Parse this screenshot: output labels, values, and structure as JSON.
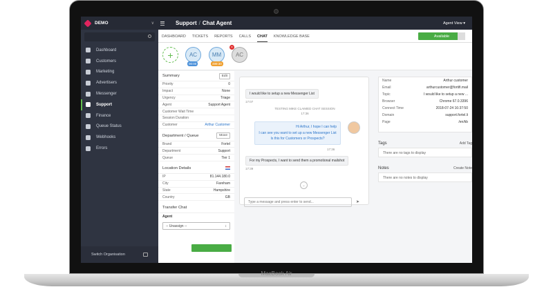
{
  "device": {
    "label": "MacBook Air"
  },
  "sidebar": {
    "brand": "DEMO",
    "items": [
      {
        "label": "Dashboard",
        "icon": "dashboard-icon"
      },
      {
        "label": "Customers",
        "icon": "customers-icon"
      },
      {
        "label": "Marketing",
        "icon": "marketing-icon"
      },
      {
        "label": "Advertisers",
        "icon": "advertisers-icon"
      },
      {
        "label": "Messenger",
        "icon": "messenger-icon"
      },
      {
        "label": "Support",
        "icon": "support-icon",
        "active": true
      },
      {
        "label": "Finance",
        "icon": "finance-icon"
      },
      {
        "label": "Queue Status",
        "icon": "queue-icon"
      },
      {
        "label": "Webhooks",
        "icon": "webhooks-icon"
      },
      {
        "label": "Errors",
        "icon": "errors-icon"
      }
    ],
    "switch_org": "Switch Organisation"
  },
  "topbar": {
    "crumb1": "Support",
    "sep": "/",
    "crumb2": "Chat Agent",
    "agent_view": "Agent View ▾"
  },
  "tabs": [
    "DASHBOARD",
    "TICKETS",
    "REPORTS",
    "CALLS",
    "CHAT",
    "KNOWLEDGE BASE"
  ],
  "active_tab": "CHAT",
  "status": {
    "label": "Available",
    "color": "#49ac44"
  },
  "sessions": [
    {
      "initials": "AC",
      "badge": "00:00"
    },
    {
      "initials": "MM",
      "badge": "499:30"
    },
    {
      "initials": "AC"
    }
  ],
  "summary": {
    "title": "Summary",
    "edit": "Edit",
    "rows": [
      {
        "k": "Priority",
        "v": "0"
      },
      {
        "k": "Impact",
        "v": "None"
      },
      {
        "k": "Urgency",
        "v": "Triage"
      },
      {
        "k": "Agent",
        "v": "Support Agent"
      },
      {
        "k": "Customer Wait Time",
        "v": ""
      },
      {
        "k": "Session Duration",
        "v": ""
      },
      {
        "k": "Customer",
        "v": "Arthur Customer"
      }
    ]
  },
  "department": {
    "title": "Department / Queue",
    "move": "Move",
    "rows": [
      {
        "k": "Brand",
        "v": "Fortel"
      },
      {
        "k": "Department",
        "v": "Support"
      },
      {
        "k": "Queue",
        "v": "Tier 1"
      }
    ]
  },
  "location": {
    "title": "Location Details",
    "rows": [
      {
        "k": "IP",
        "v": "81.144.180.0"
      },
      {
        "k": "City",
        "v": "Fareham"
      },
      {
        "k": "State",
        "v": "Hampshire"
      },
      {
        "k": "Country",
        "v": "GB"
      }
    ]
  },
  "transfer": {
    "title": "Transfer Chat",
    "agent_label": "Agent",
    "select": "-- Unassign --"
  },
  "chat": {
    "m1": "I would like to setup a new Messenger List",
    "t1": "17:07",
    "sys": "TESTING MIKE CLAIMED CHAT SESSION",
    "sys_time": "17:36",
    "out1": "Hi Arthur, I hope I can help",
    "out2": "I can see you want to set up a new Messenger List",
    "out3": "Is this for Customers or Prospects?",
    "t2": "17:36",
    "m2": "For my Prospects, I want to send them a promotional mailshot",
    "t3": "17:39",
    "placeholder": "Type a message and press enter to send..."
  },
  "info": {
    "rows": [
      {
        "k": "Name",
        "v": "Arthur customer"
      },
      {
        "k": "Email",
        "v": "arthurcustomer@fortifi.mail"
      },
      {
        "k": "Topic",
        "v": "I would like to setup a new ..."
      },
      {
        "k": "Browser",
        "v": "Chrome 67.0.3396"
      },
      {
        "k": "Connect Time",
        "v": "2018-07-24 16:37:50"
      },
      {
        "k": "Domain",
        "v": "support.fortel.li"
      },
      {
        "k": "Page",
        "v": "/en/kb"
      }
    ]
  },
  "tags": {
    "title": "Tags",
    "action": "Add Tag",
    "empty": "There are no tags to display"
  },
  "notes": {
    "title": "Notes",
    "action": "Create Note",
    "empty": "There are no notes to display"
  }
}
